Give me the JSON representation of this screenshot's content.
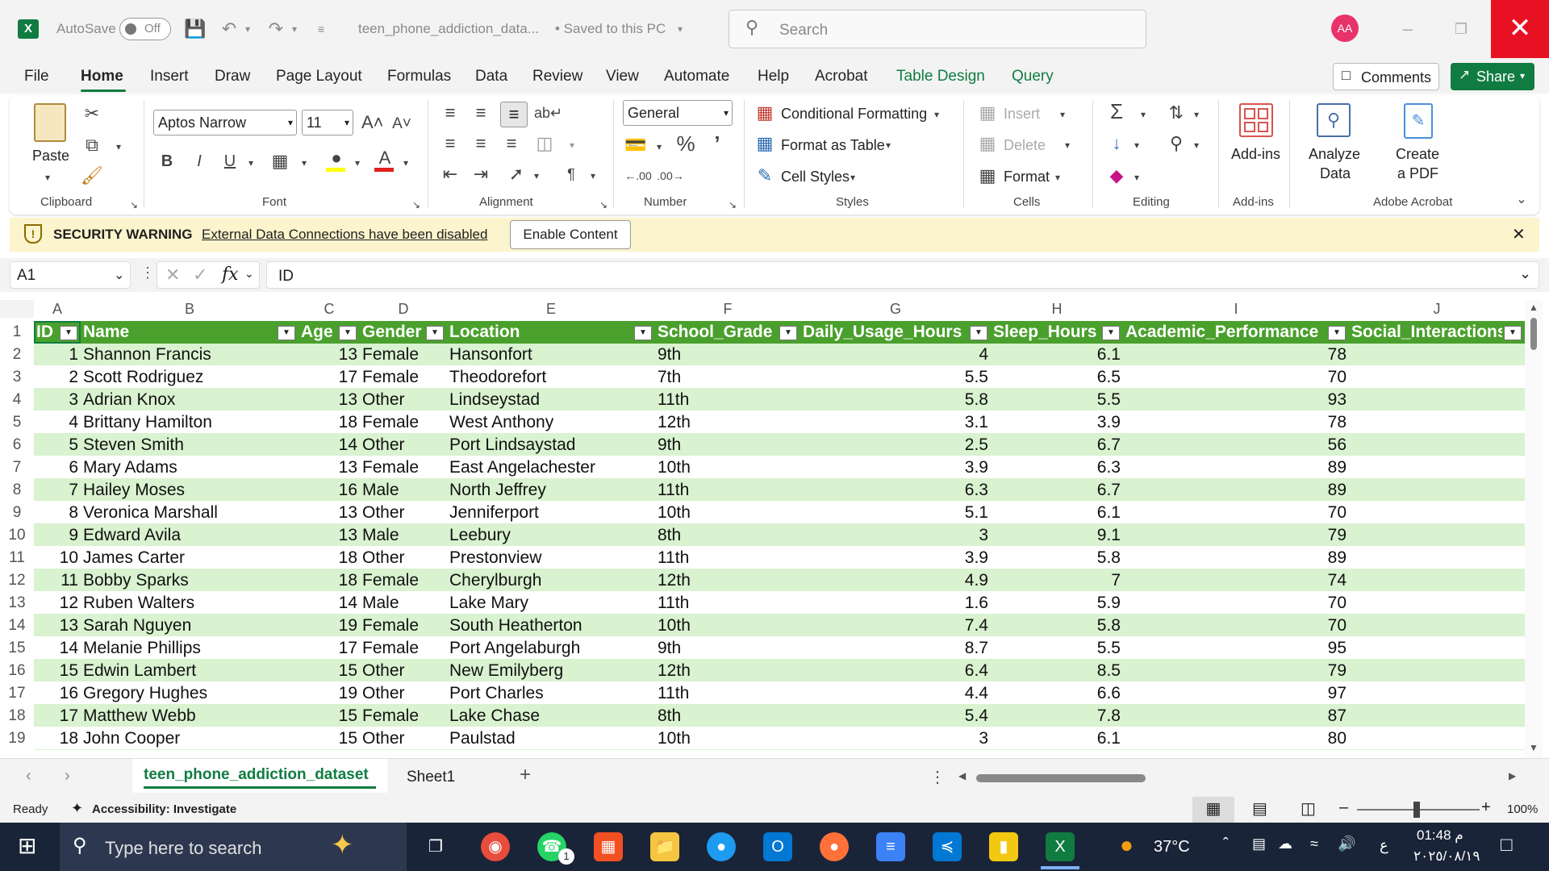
{
  "titlebar": {
    "autosave_label": "AutoSave",
    "autosave_state": "Off",
    "file_name": "teen_phone_addiction_data...",
    "save_status": "• Saved to this PC",
    "search_placeholder": "Search",
    "user_initials": "AA",
    "accent": "#107c41"
  },
  "menu": {
    "items": [
      "File",
      "Home",
      "Insert",
      "Draw",
      "Page Layout",
      "Formulas",
      "Data",
      "Review",
      "View",
      "Automate",
      "Help",
      "Acrobat",
      "Table Design",
      "Query"
    ],
    "active": "Home",
    "comments_label": "Comments",
    "share_label": "Share"
  },
  "ribbon": {
    "clipboard": {
      "paste_label": "Paste",
      "group_label": "Clipboard"
    },
    "font": {
      "font_name": "Aptos Narrow",
      "font_size": "11",
      "group_label": "Font"
    },
    "alignment": {
      "group_label": "Alignment"
    },
    "number": {
      "format": "General",
      "group_label": "Number"
    },
    "styles": {
      "conditional_formatting": "Conditional Formatting",
      "format_as_table": "Format as Table",
      "cell_styles": "Cell Styles",
      "group_label": "Styles"
    },
    "cells": {
      "insert": "Insert",
      "delete": "Delete",
      "format": "Format",
      "group_label": "Cells"
    },
    "editing": {
      "group_label": "Editing"
    },
    "addins": {
      "label": "Add-ins",
      "group_label": "Add-ins"
    },
    "analyze": {
      "label1": "Analyze",
      "label2": "Data"
    },
    "acrobat": {
      "label1": "Create",
      "label2": "a PDF",
      "group_label": "Adobe Acrobat"
    }
  },
  "security": {
    "title": "SECURITY WARNING",
    "message": "External Data Connections have been disabled",
    "button": "Enable Content"
  },
  "formula": {
    "name_box": "A1",
    "content": "ID"
  },
  "grid": {
    "columns": [
      "A",
      "B",
      "C",
      "D",
      "E",
      "F",
      "G",
      "H",
      "I",
      "J"
    ],
    "headers": [
      "ID",
      "Name",
      "Age",
      "Gender",
      "Location",
      "School_Grade",
      "Daily_Usage_Hours",
      "Sleep_Hours",
      "Academic_Performance",
      "Social_Interactions"
    ],
    "row_numbers": [
      "1",
      "2",
      "3",
      "4",
      "5",
      "6",
      "7",
      "8",
      "9",
      "10",
      "11",
      "12",
      "13",
      "14",
      "15",
      "16",
      "17",
      "18",
      "19"
    ],
    "rows": [
      [
        "1",
        "Shannon Francis",
        "13",
        "Female",
        "Hansonfort",
        "9th",
        "4",
        "6.1",
        "78"
      ],
      [
        "2",
        "Scott Rodriguez",
        "17",
        "Female",
        "Theodorefort",
        "7th",
        "5.5",
        "6.5",
        "70"
      ],
      [
        "3",
        "Adrian Knox",
        "13",
        "Other",
        "Lindseystad",
        "11th",
        "5.8",
        "5.5",
        "93"
      ],
      [
        "4",
        "Brittany Hamilton",
        "18",
        "Female",
        "West Anthony",
        "12th",
        "3.1",
        "3.9",
        "78"
      ],
      [
        "5",
        "Steven Smith",
        "14",
        "Other",
        "Port Lindsaystad",
        "9th",
        "2.5",
        "6.7",
        "56"
      ],
      [
        "6",
        "Mary Adams",
        "13",
        "Female",
        "East Angelachester",
        "10th",
        "3.9",
        "6.3",
        "89"
      ],
      [
        "7",
        "Hailey Moses",
        "16",
        "Male",
        "North Jeffrey",
        "11th",
        "6.3",
        "6.7",
        "89"
      ],
      [
        "8",
        "Veronica Marshall",
        "13",
        "Other",
        "Jenniferport",
        "10th",
        "5.1",
        "6.1",
        "70"
      ],
      [
        "9",
        "Edward Avila",
        "13",
        "Male",
        "Leebury",
        "8th",
        "3",
        "9.1",
        "79"
      ],
      [
        "10",
        "James Carter",
        "18",
        "Other",
        "Prestonview",
        "11th",
        "3.9",
        "5.8",
        "89"
      ],
      [
        "11",
        "Bobby Sparks",
        "18",
        "Female",
        "Cherylburgh",
        "12th",
        "4.9",
        "7",
        "74"
      ],
      [
        "12",
        "Ruben Walters",
        "14",
        "Male",
        "Lake Mary",
        "11th",
        "1.6",
        "5.9",
        "70"
      ],
      [
        "13",
        "Sarah Nguyen",
        "19",
        "Female",
        "South Heatherton",
        "10th",
        "7.4",
        "5.8",
        "70"
      ],
      [
        "14",
        "Melanie Phillips",
        "17",
        "Female",
        "Port Angelaburgh",
        "9th",
        "8.7",
        "5.5",
        "95"
      ],
      [
        "15",
        "Edwin Lambert",
        "15",
        "Other",
        "New Emilyberg",
        "12th",
        "6.4",
        "8.5",
        "79"
      ],
      [
        "16",
        "Gregory Hughes",
        "19",
        "Other",
        "Port Charles",
        "11th",
        "4.4",
        "6.6",
        "97"
      ],
      [
        "17",
        "Matthew Webb",
        "15",
        "Female",
        "Lake Chase",
        "8th",
        "5.4",
        "7.8",
        "87"
      ],
      [
        "18",
        "John Cooper",
        "15",
        "Other",
        "Paulstad",
        "10th",
        "3",
        "6.1",
        "80"
      ]
    ],
    "header_color": "#4aa02c",
    "band_color": "#d9f2d0"
  },
  "tabs": {
    "active": "teen_phone_addiction_dataset",
    "other": "Sheet1"
  },
  "status": {
    "ready": "Ready",
    "accessibility": "Accessibility: Investigate",
    "zoom": "100%"
  },
  "taskbar": {
    "search_placeholder": "Type here to search",
    "temperature": "37°C",
    "time": "01:48 م",
    "date": "٢٠٢٥/٠٨/١٩",
    "lang": "ع",
    "notif_count": "1"
  }
}
